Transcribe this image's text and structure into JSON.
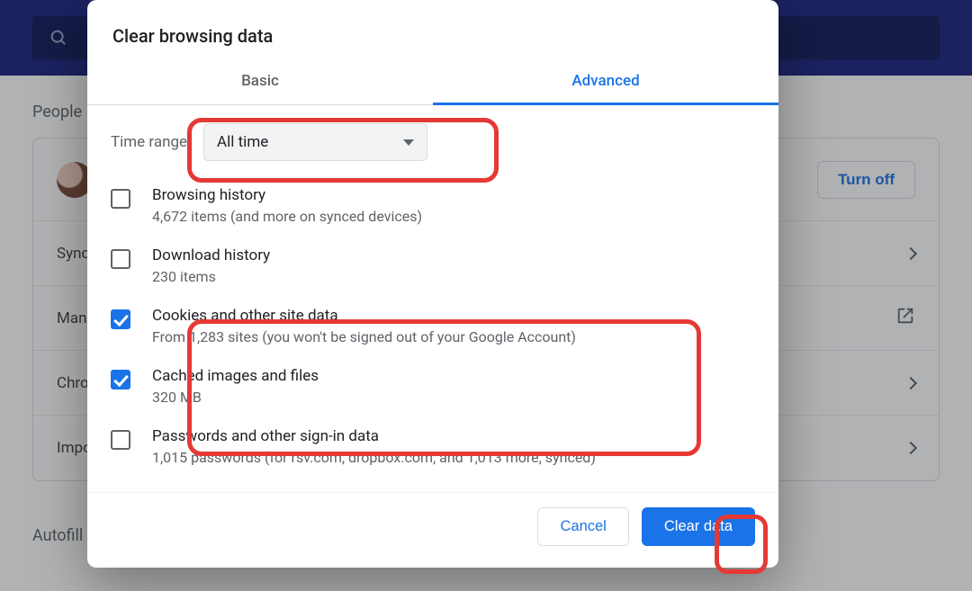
{
  "bg": {
    "section_people": "People",
    "section_autofill": "Autofill",
    "turn_off": "Turn off",
    "rows": {
      "sync": "Sync",
      "manage": "Manage",
      "chrome": "Chrome",
      "import": "Import"
    }
  },
  "dialog": {
    "title": "Clear browsing data",
    "tabs": {
      "basic": "Basic",
      "advanced": "Advanced"
    },
    "time_label": "Time range",
    "time_value": "All time",
    "items": [
      {
        "title": "Browsing history",
        "sub": "4,672 items (and more on synced devices)",
        "checked": false
      },
      {
        "title": "Download history",
        "sub": "230 items",
        "checked": false
      },
      {
        "title": "Cookies and other site data",
        "sub": "From 1,283 sites (you won't be signed out of your Google Account)",
        "checked": true
      },
      {
        "title": "Cached images and files",
        "sub": "320 MB",
        "checked": true
      },
      {
        "title": "Passwords and other sign-in data",
        "sub": "1,015 passwords (for rsv.com, dropbox.com, and 1,013 more, synced)",
        "checked": false
      }
    ],
    "cancel": "Cancel",
    "clear": "Clear data"
  }
}
